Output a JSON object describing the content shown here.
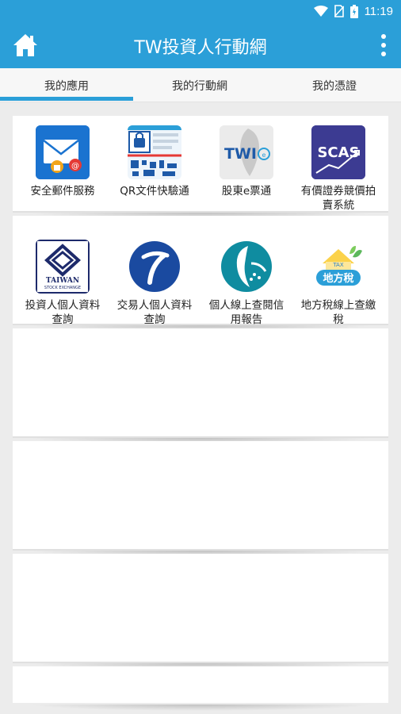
{
  "status_bar": {
    "time": "11:19"
  },
  "app_bar": {
    "title": "TW投資人行動網"
  },
  "tabs": [
    {
      "label": "我的應用"
    },
    {
      "label": "我的行動網"
    },
    {
      "label": "我的憑證"
    }
  ],
  "apps": [
    {
      "label": "安全郵件服務",
      "icon": "secure-mail-icon"
    },
    {
      "label": "QR文件快驗通",
      "icon": "qr-document-icon"
    },
    {
      "label": "股東e票通",
      "icon": "twi-evote-icon"
    },
    {
      "label": "有價證券競價拍賣系統",
      "icon": "scas-icon",
      "icon_text": "SCAS"
    },
    {
      "label": "投資人個人資料查詢",
      "icon": "taiwan-stock-exchange-icon",
      "icon_text": "TAIWAN",
      "icon_subtext": "STOCK EXCHANGE"
    },
    {
      "label": "交易人個人資料查詢",
      "icon": "taifex-icon"
    },
    {
      "label": "個人線上查閱信用報告",
      "icon": "jcic-credit-icon"
    },
    {
      "label": "地方稅線上查繳稅",
      "icon": "local-tax-icon",
      "icon_text": "地方稅",
      "icon_subtext": "TAX"
    }
  ],
  "colors": {
    "primary": "#2b9fd8",
    "background": "#ececec"
  }
}
